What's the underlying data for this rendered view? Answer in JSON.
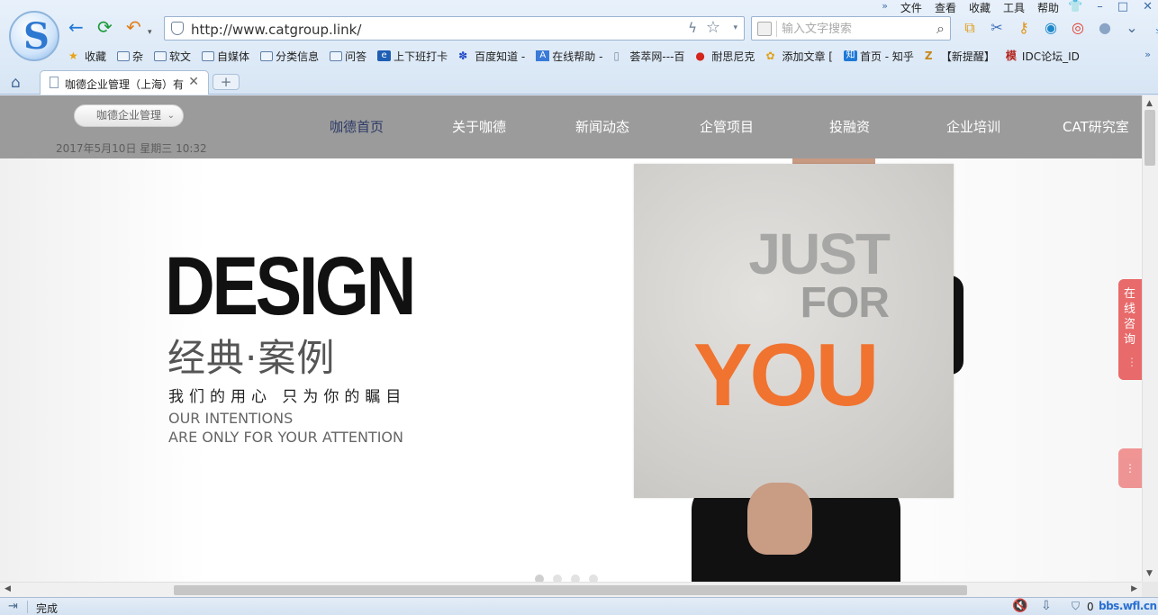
{
  "browser": {
    "menu": {
      "double_chevron": "»",
      "items": [
        "文件",
        "查看",
        "收藏",
        "工具",
        "帮助"
      ]
    },
    "window_controls": {
      "shirt": "👕",
      "minimize": "–",
      "maximize": "□",
      "close": "✕"
    },
    "nav": {
      "back": "←",
      "refresh": "⟳",
      "undo": "↶",
      "undo_caret": "▾"
    },
    "address": {
      "url": "http://www.catgroup.link/",
      "bolt": "ϟ",
      "star": "☆",
      "dropdown": "▾"
    },
    "search": {
      "placeholder": "输入文字搜索",
      "value": "",
      "icon": "⌕"
    },
    "toolbar_icons": [
      {
        "name": "screenshot-icon",
        "glyph": "⧉",
        "color": "#e39a12"
      },
      {
        "name": "scissors-icon",
        "glyph": "✂",
        "color": "#3f6fb8"
      },
      {
        "name": "key-icon",
        "glyph": "⚷",
        "color": "#e2951c"
      },
      {
        "name": "search-tool-icon",
        "glyph": "◉",
        "color": "#1e88c9"
      },
      {
        "name": "weibo-icon",
        "glyph": "◎",
        "color": "#e0392b"
      },
      {
        "name": "chat-icon",
        "glyph": "●",
        "color": "#8aa4c6"
      },
      {
        "name": "more-icon",
        "glyph": "⌄",
        "color": "#4a6a90"
      },
      {
        "name": "download-icon",
        "glyph": "⤓",
        "color": "#2a75c4"
      }
    ],
    "bookmarks": [
      {
        "label": "收藏",
        "icon": "star"
      },
      {
        "label": "杂",
        "icon": "folder"
      },
      {
        "label": "软文",
        "icon": "folder"
      },
      {
        "label": "自媒体",
        "icon": "folder"
      },
      {
        "label": "分类信息",
        "icon": "folder"
      },
      {
        "label": "问答",
        "icon": "folder"
      },
      {
        "label": "上下班打卡",
        "icon": "ie"
      },
      {
        "label": "百度知道 -",
        "icon": "paw"
      },
      {
        "label": "在线帮助 -",
        "icon": "a"
      },
      {
        "label": "荟萃网---百",
        "icon": "page"
      },
      {
        "label": "耐思尼克",
        "icon": "e"
      },
      {
        "label": "添加文章 [",
        "icon": "gear"
      },
      {
        "label": "首页 - 知乎",
        "icon": "zhi"
      },
      {
        "label": "【新提醒】",
        "icon": "z"
      },
      {
        "label": "IDC论坛_ID",
        "icon": "mo"
      }
    ],
    "bookmarks_more": "»",
    "home": "⌂",
    "tab": {
      "title": "咖德企业管理（上海）有",
      "close": "✕"
    },
    "new_tab": "+",
    "status": {
      "text": "完成",
      "sidebar_toggle": "⇥",
      "mute": "🔇",
      "dl": "⇩",
      "shield": "⛉",
      "count": "0",
      "watermark": "bbs.wfl.cn"
    },
    "scroll": {
      "up": "▲",
      "down": "▼",
      "left": "◀",
      "right": "▶"
    }
  },
  "site": {
    "brand_dropdown": "咖德企业管理",
    "brand_chevron": "⌄",
    "datetime": "2017年5月10日 星期三 10:32",
    "nav": [
      "咖德首页",
      "关于咖德",
      "新闻动态",
      "企管项目",
      "投融资",
      "企业培训",
      "CAT研究室"
    ],
    "active_nav": 0,
    "hero": {
      "design": "DESIGN",
      "cn_title": "经典·案例",
      "cn_sub": "我们的用心 只为你的瞩目",
      "en_line1": "OUR INTENTIONS",
      "en_line2": "ARE ONLY FOR YOUR ATTENTION",
      "sign_just": "JUST",
      "sign_for": "FOR",
      "sign_you": "YOU",
      "slides": 4,
      "active_slide": 0
    },
    "float_consult": "在线咨询",
    "float_grip": "⋮",
    "colors": {
      "header_bg": "#9b9b9b",
      "accent_orange": "#f07330",
      "consult_red": "#e86a6a",
      "active_nav": "#2d3a66"
    }
  }
}
